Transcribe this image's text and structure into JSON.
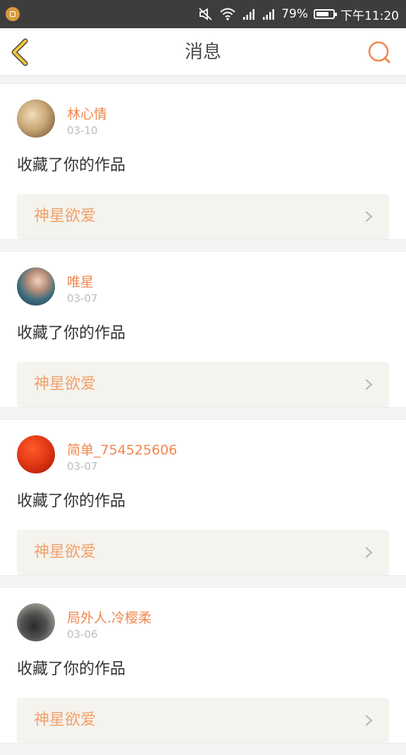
{
  "status_bar": {
    "battery_percent": "79%",
    "battery_level": 0.79,
    "time": "下午11:20",
    "icons": [
      "app-notification-icon",
      "mute-icon",
      "wifi-icon",
      "signal-icon",
      "signal-icon",
      "battery-icon"
    ]
  },
  "header": {
    "title": "消息",
    "back_icon": "chevron-left-icon",
    "search_icon": "search-icon"
  },
  "colors": {
    "accent": "#f0874f",
    "back_arrow": "#f3c63c",
    "work_title": "#f2a06a",
    "date": "#bcbcbc",
    "card_inner_bg": "#f4f3ee"
  },
  "messages": [
    {
      "user": "林心情",
      "date": "03-10",
      "action": "收藏了你的作品",
      "work": "神星欲爱"
    },
    {
      "user": "唯星",
      "date": "03-07",
      "action": "收藏了你的作品",
      "work": "神星欲爱"
    },
    {
      "user": "简单_754525606",
      "date": "03-07",
      "action": "收藏了你的作品",
      "work": "神星欲爱"
    },
    {
      "user": "局外人.冷樱柔",
      "date": "03-06",
      "action": "收藏了你的作品",
      "work": "神星欲爱"
    }
  ]
}
